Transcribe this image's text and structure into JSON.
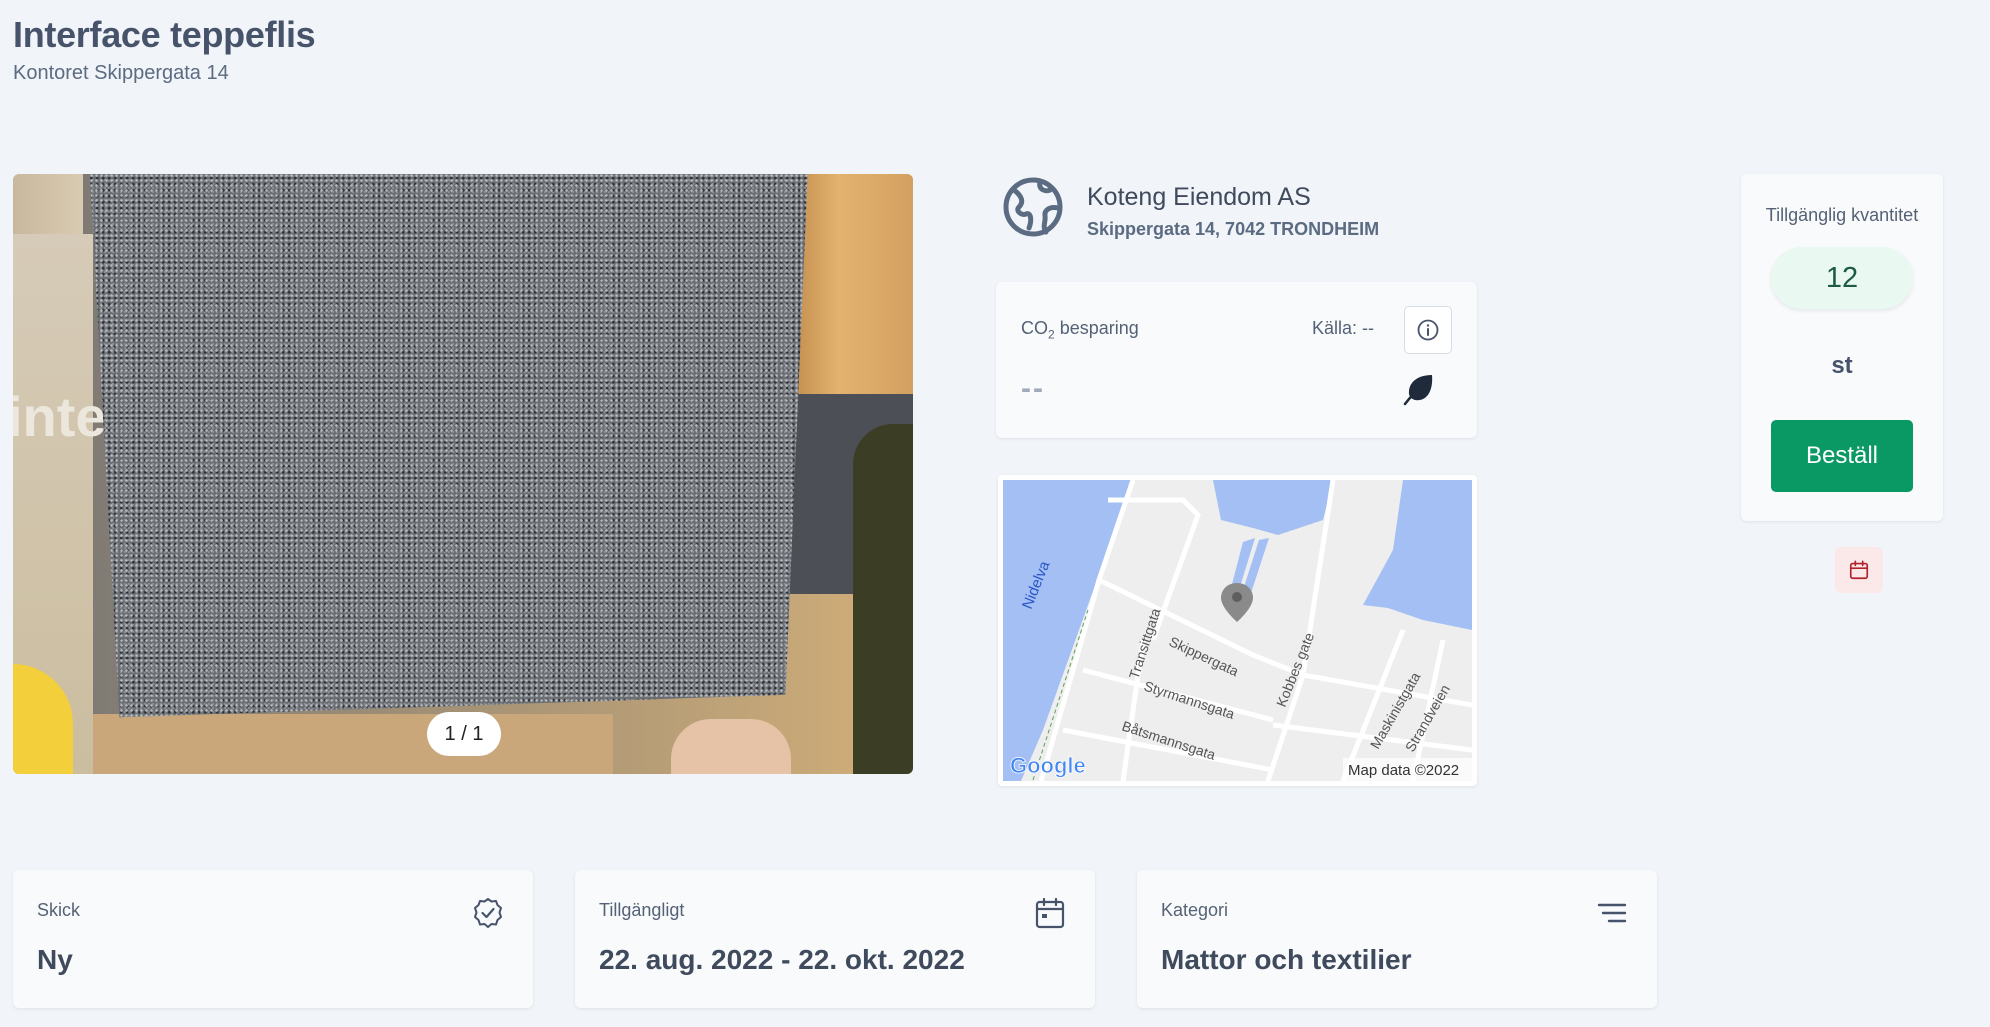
{
  "header": {
    "title": "Interface teppeflis",
    "subtitle": "Kontoret Skippergata 14"
  },
  "gallery": {
    "counter": "1 / 1",
    "photo_text": "inter"
  },
  "seller": {
    "name": "Koteng Eiendom AS",
    "address": "Skippergata 14, 7042 TRONDHEIM"
  },
  "co2": {
    "label_prefix": "CO",
    "label_sub": "2",
    "label_suffix": " besparing",
    "source": "Källa: --",
    "value": "--"
  },
  "map": {
    "streets": [
      "Nidelva",
      "Transittgata",
      "Skippergata",
      "Kobbes gate",
      "Styrmannsgata",
      "Båtsmannsgata",
      "Maskinistgata",
      "Strandveien"
    ],
    "attribution": "Map data ©2022",
    "google_logo": "Google"
  },
  "quantity": {
    "label": "Tillgänglig kvantitet",
    "value": "12",
    "unit": "st",
    "order_label": "Beställ"
  },
  "cards": [
    {
      "label": "Skick",
      "value": "Ny",
      "icon": "badge-check-icon"
    },
    {
      "label": "Tillgängligt",
      "value": "22. aug. 2022 - 22. okt. 2022",
      "icon": "calendar-icon"
    },
    {
      "label": "Kategori",
      "value": "Mattor och textilier",
      "icon": "menu-lines-icon"
    }
  ],
  "colors": {
    "background": "#f1f4f8",
    "accent": "#0a9964",
    "quantity_pill": "#e9f8f0",
    "calendar_button": "#fbe9ea",
    "water": "#a3bff3"
  }
}
